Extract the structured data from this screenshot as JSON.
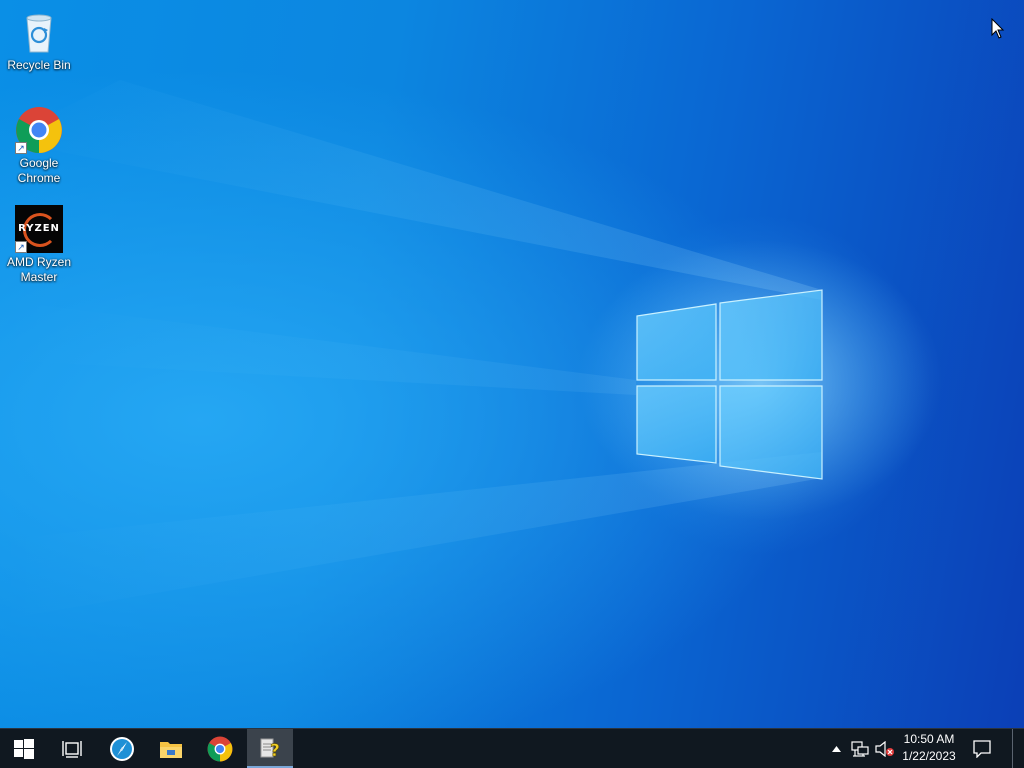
{
  "desktop": {
    "icons": [
      {
        "label": "Recycle Bin",
        "icon": "recycle-bin-icon"
      },
      {
        "label": "Google Chrome",
        "icon": "chrome-icon",
        "shortcut": true
      },
      {
        "label": "AMD Ryzen Master",
        "icon": "ryzen-master-icon",
        "shortcut": true,
        "logo_text": "RYZEN"
      }
    ]
  },
  "taskbar": {
    "pinned": [
      {
        "name": "start",
        "icon": "windows-logo-icon"
      },
      {
        "name": "task-view",
        "icon": "task-view-icon"
      },
      {
        "name": "app-1",
        "icon": "compass-app-icon"
      },
      {
        "name": "file-explorer",
        "icon": "folder-icon"
      },
      {
        "name": "chrome",
        "icon": "chrome-icon"
      },
      {
        "name": "active-app",
        "icon": "help-document-icon",
        "active": true
      }
    ],
    "tray": {
      "overflow_icon": "chevron-up-icon",
      "network_icon": "network-icon",
      "volume_icon": "volume-muted-icon",
      "notifications_icon": "action-center-icon"
    },
    "clock": {
      "time": "10:50 AM",
      "date": "1/22/2023"
    }
  },
  "colors": {
    "taskbar_bg": "#101820",
    "desktop_blue": "#0a7ee0",
    "chrome_red": "#db4437",
    "chrome_yellow": "#f4c20d",
    "chrome_green": "#0f9d58",
    "chrome_blue": "#4285f4",
    "ryzen_orange": "#d9531e"
  }
}
